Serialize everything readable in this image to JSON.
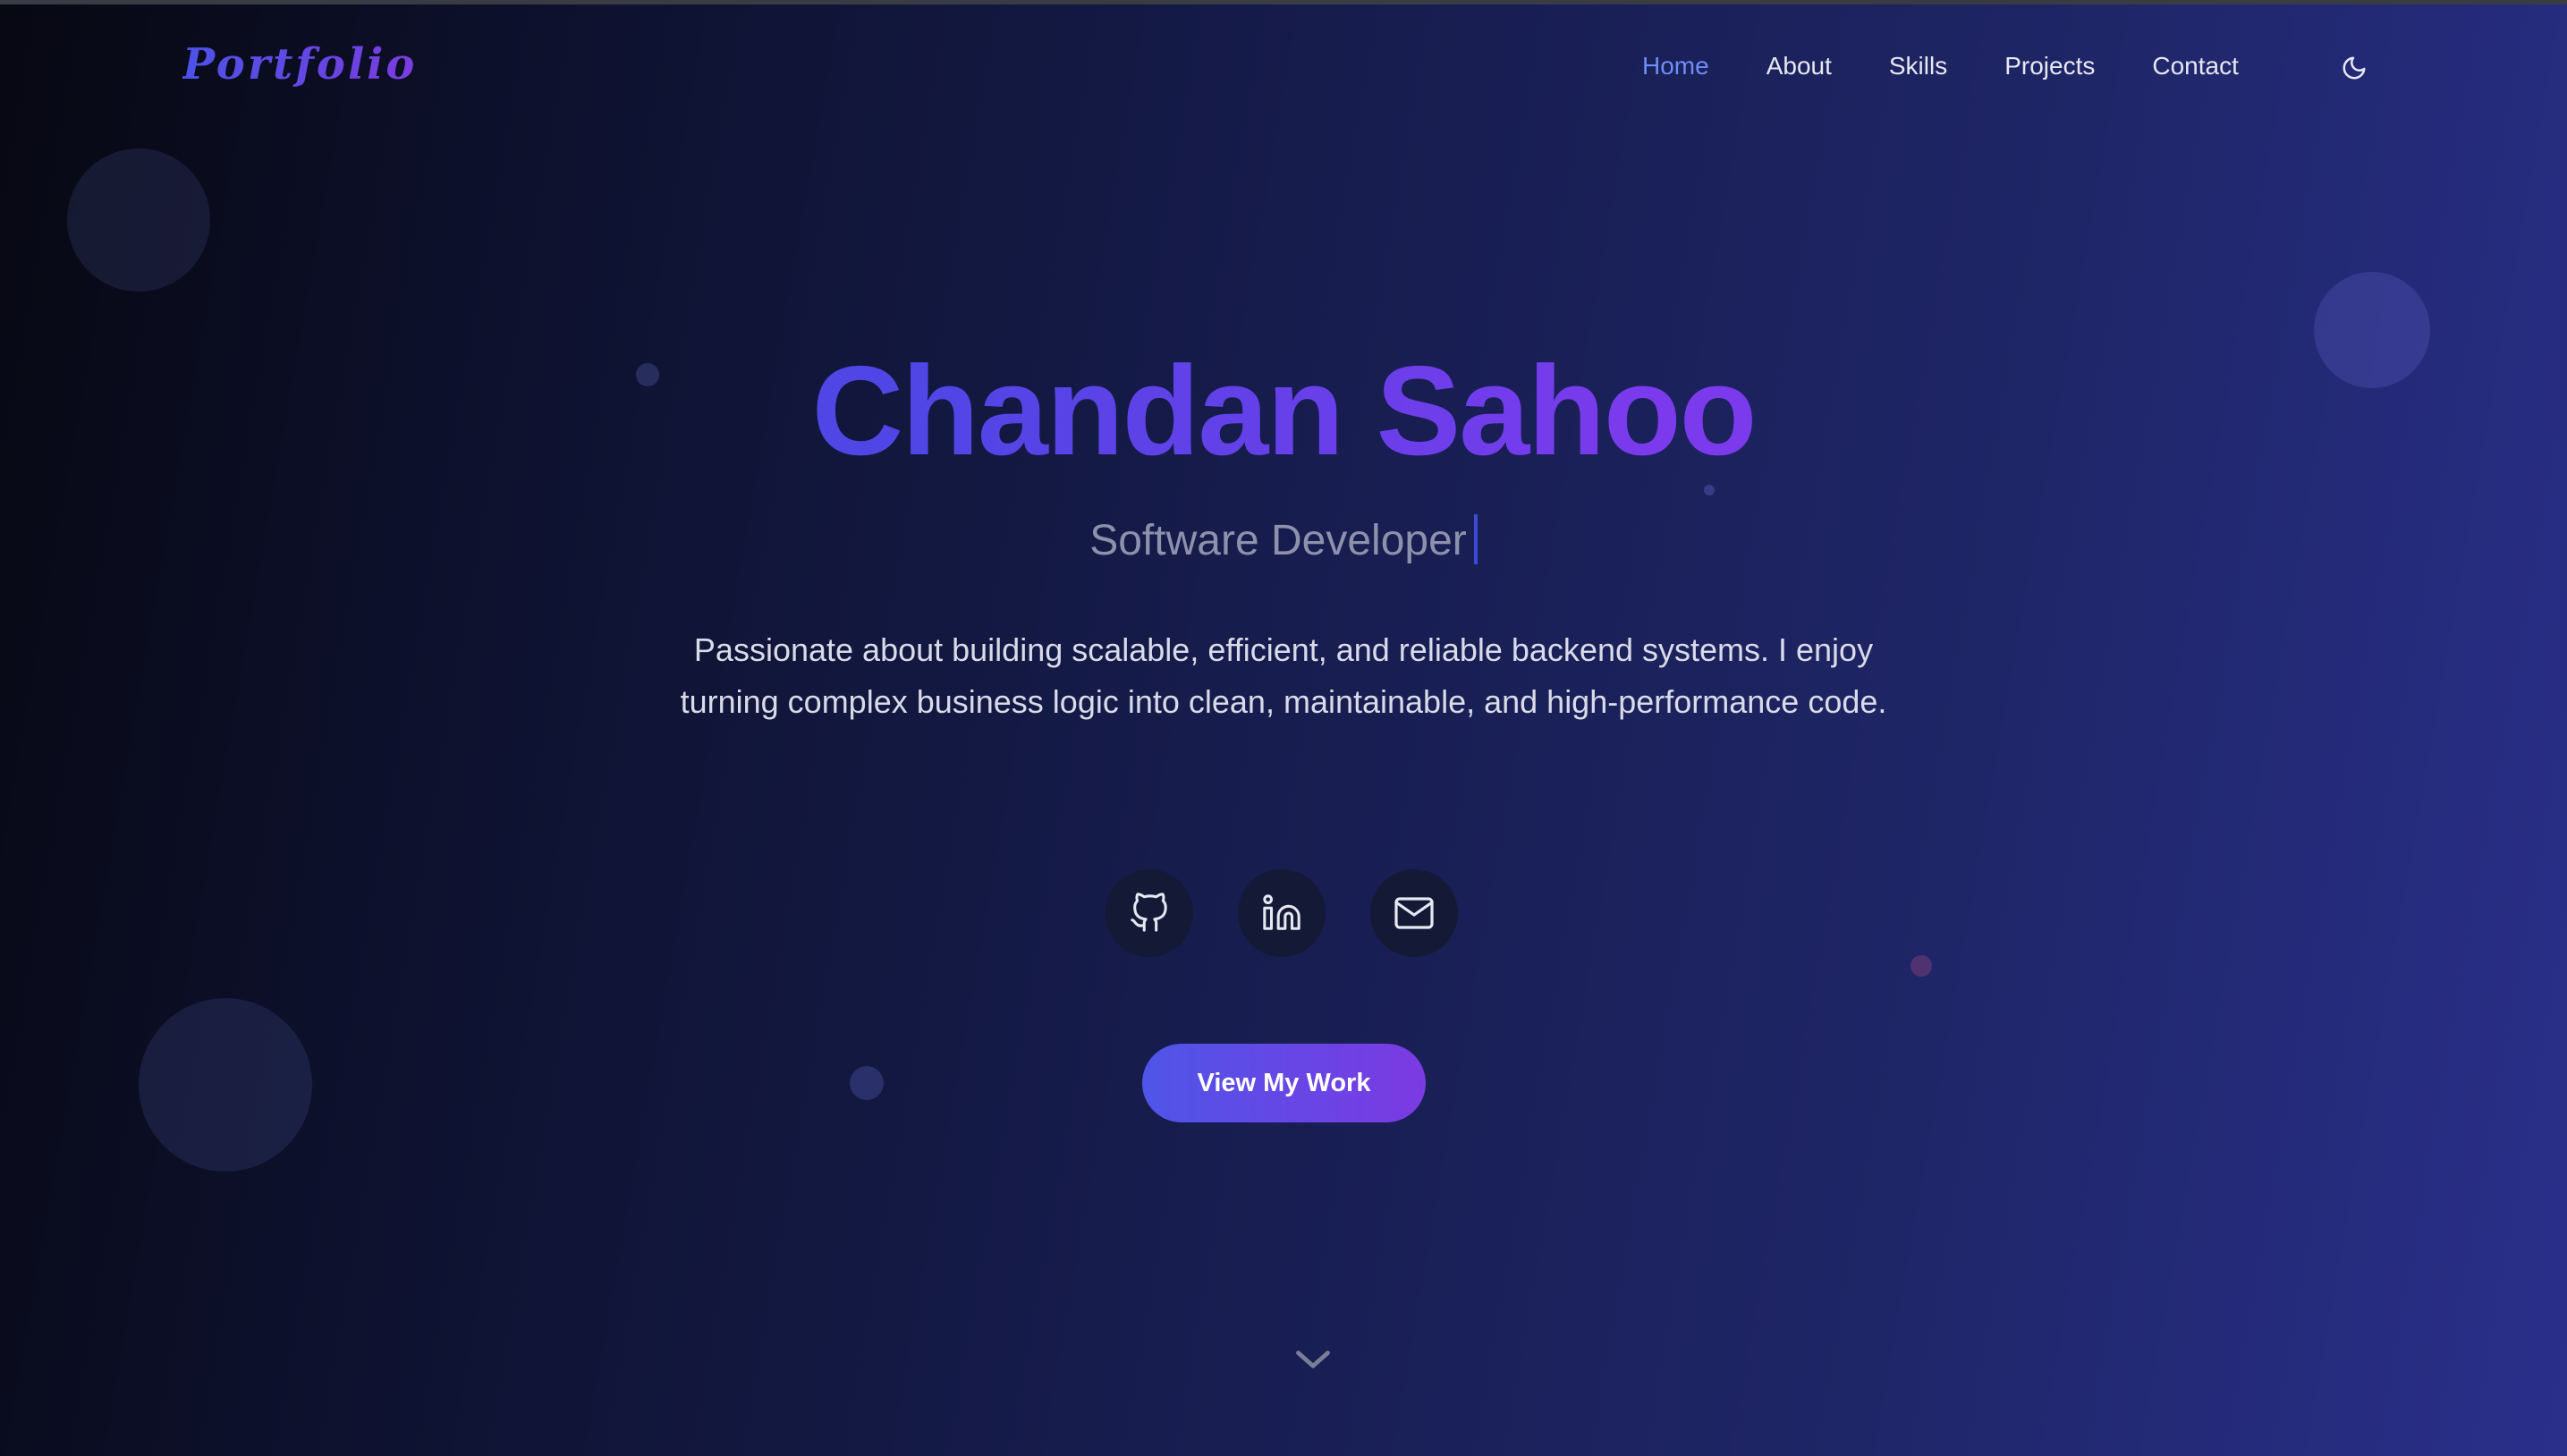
{
  "brand": {
    "logo_text": "Portfolio"
  },
  "nav": {
    "items": [
      {
        "label": "Home",
        "active": true
      },
      {
        "label": "About",
        "active": false
      },
      {
        "label": "Skills",
        "active": false
      },
      {
        "label": "Projects",
        "active": false
      },
      {
        "label": "Contact",
        "active": false
      }
    ],
    "theme_toggle_icon": "moon-icon"
  },
  "hero": {
    "name": "Chandan Sahoo",
    "role": "Software Developer",
    "description": "Passionate about building scalable, efficient, and reliable backend systems. I enjoy turning complex business logic into clean, maintainable, and high-performance code.",
    "socials": [
      {
        "icon": "github-icon"
      },
      {
        "icon": "linkedin-icon"
      },
      {
        "icon": "mail-icon"
      }
    ],
    "cta_label": "View My Work",
    "scroll_icon": "chevron-down-icon"
  },
  "colors": {
    "accent_start": "#4f46e5",
    "accent_end": "#7c3aed",
    "nav_active": "#6f8df5",
    "background_dark": "#070812",
    "background_light": "#2a2f8a"
  }
}
